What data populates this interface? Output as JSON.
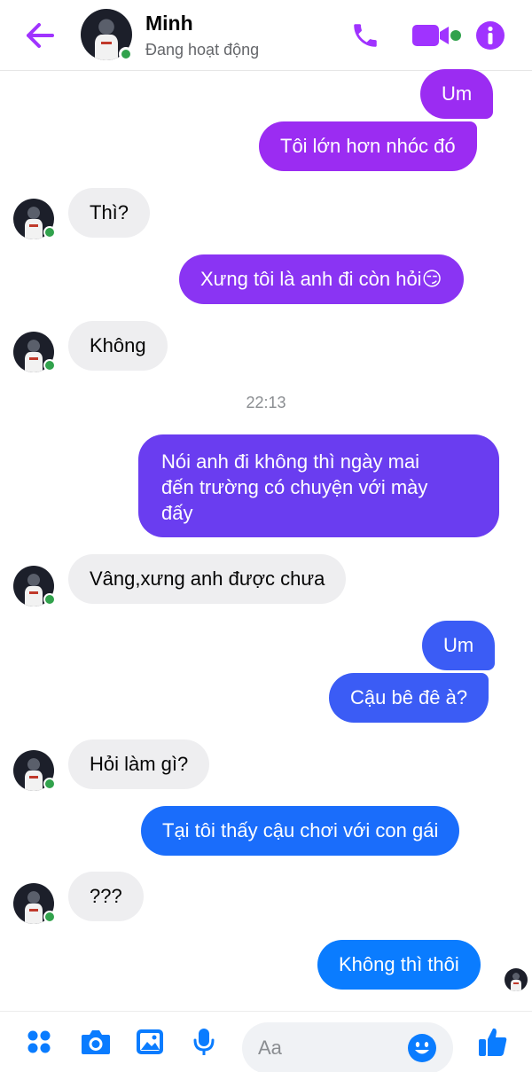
{
  "header": {
    "contact_name": "Minh",
    "status": "Đang hoạt động",
    "icons": [
      "back-arrow-icon",
      "phone-icon",
      "video-camera-icon",
      "info-icon"
    ]
  },
  "colors": {
    "accent": "#a033ff",
    "bubble_purple": "#9b2cf2",
    "bubble_violet": "#6a3df0",
    "bubble_blue": "#0a7cff",
    "incoming_bg": "#eeeef0",
    "online": "#31a24c"
  },
  "messages": [
    {
      "dir": "out",
      "text": "Um"
    },
    {
      "dir": "out",
      "text": "Tôi lớn hơn nhóc đó"
    },
    {
      "dir": "in",
      "text": "Thì?"
    },
    {
      "dir": "out",
      "text": "Xưng tôi là anh đi còn hỏi",
      "emoji": "😏"
    },
    {
      "dir": "in",
      "text": "Không"
    },
    {
      "dir": "out",
      "lines": [
        "Nói anh đi không thì ngày mai",
        "đến trường có chuyện với mày",
        "đấy"
      ]
    },
    {
      "dir": "in",
      "text": "Vâng,xưng anh được chưa"
    },
    {
      "dir": "out",
      "text": "Um"
    },
    {
      "dir": "out",
      "text": "Cậu bê đê à?"
    },
    {
      "dir": "in",
      "text": "Hỏi làm gì?"
    },
    {
      "dir": "out",
      "text": "Tại tôi thấy cậu chơi với con gái"
    },
    {
      "dir": "in",
      "text": "???"
    },
    {
      "dir": "out",
      "text": "Không thì thôi"
    }
  ],
  "timestamp": "22:13",
  "composer": {
    "placeholder": "Aa",
    "icons": [
      "apps-menu-icon",
      "camera-icon",
      "gallery-icon",
      "microphone-icon",
      "emoji-icon",
      "thumbs-up-icon"
    ]
  }
}
